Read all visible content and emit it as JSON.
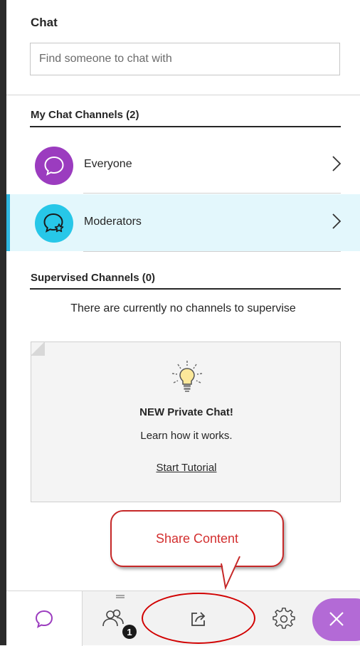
{
  "panel": {
    "title": "Chat",
    "search_placeholder": "Find someone to chat with"
  },
  "my_channels": {
    "heading": "My Chat Channels (2)",
    "items": [
      {
        "label": "Everyone",
        "icon": "chat-bubble-icon",
        "color": "#9b3cbf",
        "active": false
      },
      {
        "label": "Moderators",
        "icon": "moderator-chat-icon",
        "color": "#27c7e8",
        "active": true
      }
    ]
  },
  "supervised": {
    "heading": "Supervised Channels (0)",
    "empty_message": "There are currently no channels to supervise"
  },
  "promo": {
    "icon": "lightbulb-icon",
    "headline": "NEW Private Chat!",
    "subtext": "Learn how it works.",
    "link": "Start Tutorial"
  },
  "callout": {
    "text": "Share Content",
    "color": "#d32f2f"
  },
  "bottom_bar": {
    "tabs": [
      {
        "name": "chat",
        "icon": "chat-icon"
      },
      {
        "name": "attendees",
        "icon": "attendees-icon",
        "badge": "1"
      },
      {
        "name": "share-content",
        "icon": "share-icon"
      },
      {
        "name": "settings",
        "icon": "gear-icon"
      },
      {
        "name": "close",
        "icon": "close-icon",
        "color": "#b36ad6"
      }
    ]
  }
}
